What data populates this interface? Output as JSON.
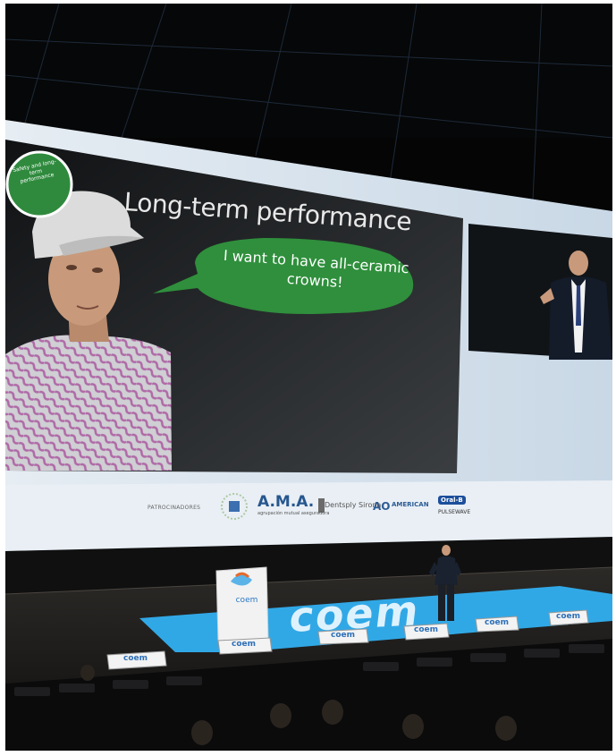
{
  "slide": {
    "title": "Long-term performance",
    "bubble": "I want to have all-ceramic crowns!",
    "badge": "Safety and long-term performance"
  },
  "sponsors": {
    "label": "PATROCINADORES",
    "ama": "A.M.A.",
    "ama_sub": "agrupación mutual aseguradora",
    "dentsply": "Dentsply Sirona",
    "american": "AMERICAN",
    "oralb": "Oral-B",
    "oralb_sub": "PULSEWAVE"
  },
  "stage": {
    "floor_mat": "coem",
    "podium": "coem",
    "sign": "coem"
  },
  "colors": {
    "screen_bg": "#dde6ef",
    "slide_bg": "#1b1d1f",
    "bubble": "#2f8f3c",
    "badge": "#2f8a3d",
    "mat": "#31a8e6"
  }
}
